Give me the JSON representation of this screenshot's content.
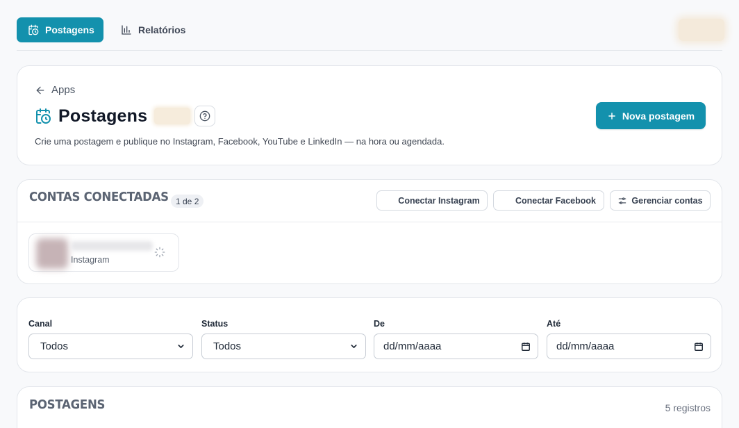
{
  "nav": {
    "tabs": [
      {
        "label": "Postagens",
        "icon": "calendar-clock-icon",
        "active": true
      },
      {
        "label": "Relatórios",
        "icon": "bar-chart-icon",
        "active": false
      }
    ]
  },
  "header": {
    "back_label": "Apps",
    "title": "Postagens",
    "description": "Crie uma postagem e publique no Instagram, Facebook, YouTube e LinkedIn — na hora ou agendada.",
    "new_post_label": "Nova postagem"
  },
  "accounts": {
    "title": "CONTAS CONECTADAS",
    "count_badge": "1 de 2",
    "buttons": {
      "connect_instagram": "Conectar Instagram",
      "connect_facebook": "Conectar Facebook",
      "manage_accounts": "Gerenciar contas"
    },
    "items": [
      {
        "platform": "Instagram"
      }
    ]
  },
  "filters": {
    "canal": {
      "label": "Canal",
      "value": "Todos"
    },
    "status": {
      "label": "Status",
      "value": "Todos"
    },
    "de": {
      "label": "De",
      "value": "dd/mm/aaaa"
    },
    "ate": {
      "label": "Até",
      "value": "dd/mm/aaaa"
    }
  },
  "posts": {
    "title": "POSTAGENS",
    "records": "5 registros"
  },
  "colors": {
    "accent": "#1391ad",
    "background": "#f8f9fb",
    "card": "#ffffff"
  }
}
